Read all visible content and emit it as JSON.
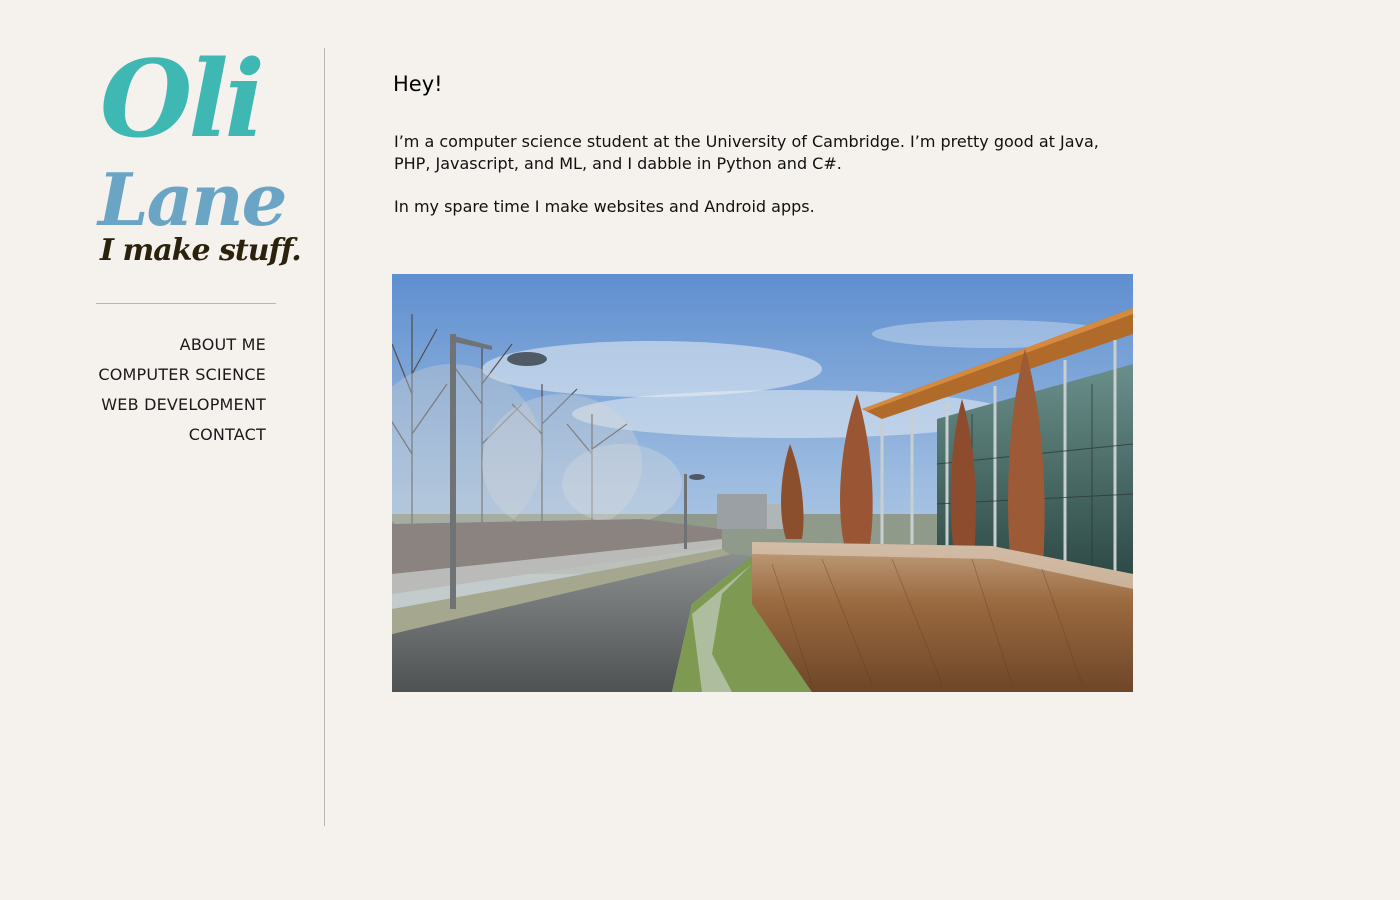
{
  "logo": {
    "first_name": "Oli",
    "last_name": "Lane",
    "tagline": "I make stuff."
  },
  "colors": {
    "first_name": "#3fb8b4",
    "last_name": "#6aa5c6",
    "tagline": "#2a220d",
    "background": "#f5f1ec"
  },
  "nav": {
    "items": [
      {
        "label": "ABOUT ME"
      },
      {
        "label": "COMPUTER SCIENCE"
      },
      {
        "label": "WEB DEVELOPMENT"
      },
      {
        "label": "CONTACT"
      }
    ]
  },
  "main": {
    "heading": "Hey!",
    "paragraph_1": "I’m a computer science student at the University of Cambridge. I’m pretty good at Java, PHP, Javascript, and ML, and I dabble in Python and C#.",
    "paragraph_2": "In my spare time I make websites and Android apps."
  }
}
